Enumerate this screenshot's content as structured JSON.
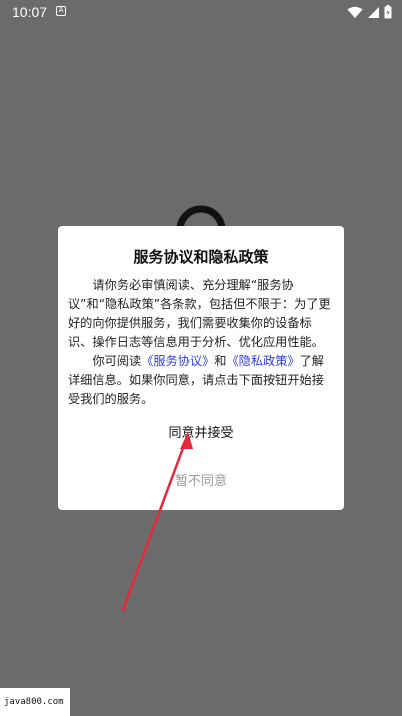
{
  "status_bar": {
    "time": "10:07",
    "notification_glyph": "A",
    "icons": [
      "wifi-icon",
      "signal-icon",
      "battery-icon"
    ]
  },
  "dialog": {
    "title": "服务协议和隐私政策",
    "paragraph1": "请你务必审慎阅读、充分理解“服务协议”和“隐私政策”各条款，包括但不限于：为了更好的向你提供服务，我们需要收集你的设备标识、操作日志等信息用于分析、优化应用性能。",
    "paragraph2_prefix": "你可阅读",
    "service_link": "《服务协议》",
    "and_text": "和",
    "privacy_link": "《隐私政策》",
    "paragraph2_suffix": "了解详细信息。如果你同意，请点击下面按钮开始接受我们的服务。",
    "agree_label": "同意并接受",
    "disagree_label": "暂不同意"
  },
  "watermark": "java800.com",
  "colors": {
    "overlay": "#6b6b6b",
    "link": "#2f3ed6",
    "disagree": "#9a9a9a",
    "arrow": "#e5283a"
  }
}
